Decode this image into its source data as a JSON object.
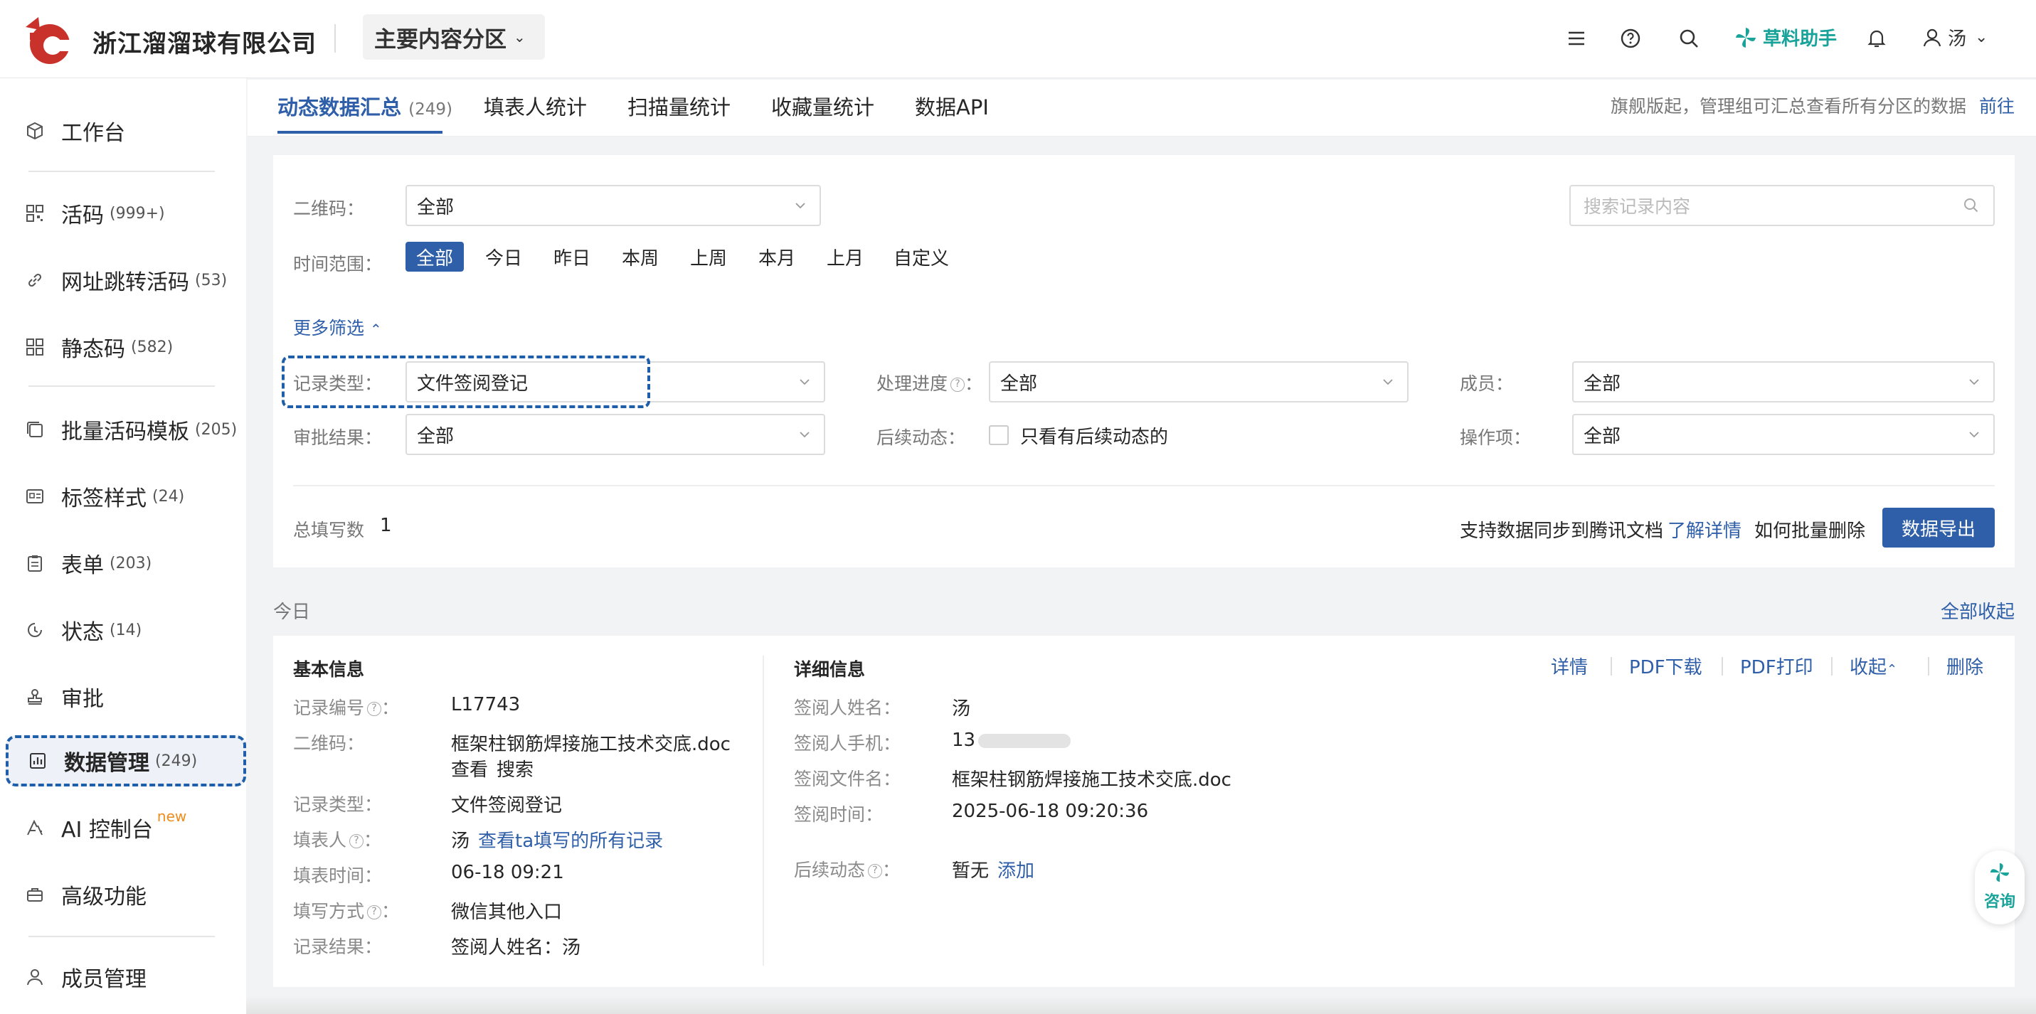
{
  "header": {
    "company": "浙江溜溜球有限公司",
    "zone": "主要内容分区",
    "helper": "草料助手",
    "user": "汤"
  },
  "sidebar": {
    "items": [
      {
        "label": "工作台",
        "count": ""
      },
      {
        "label": "活码",
        "count": "(999+)"
      },
      {
        "label": "网址跳转活码",
        "count": "(53)"
      },
      {
        "label": "静态码",
        "count": "(582)"
      },
      {
        "label": "批量活码模板",
        "count": "(205)"
      },
      {
        "label": "标签样式",
        "count": "(24)"
      },
      {
        "label": "表单",
        "count": "(203)"
      },
      {
        "label": "状态",
        "count": "(14)"
      },
      {
        "label": "审批",
        "count": ""
      },
      {
        "label": "数据管理",
        "count": "(249)"
      },
      {
        "label": "AI 控制台",
        "count": "",
        "tag": "new"
      },
      {
        "label": "高级功能",
        "count": ""
      },
      {
        "label": "成员管理",
        "count": ""
      }
    ]
  },
  "tabs": {
    "items": [
      {
        "label": "动态数据汇总",
        "sub": "(249)"
      },
      {
        "label": "填表人统计",
        "sub": ""
      },
      {
        "label": "扫描量统计",
        "sub": ""
      },
      {
        "label": "收藏量统计",
        "sub": ""
      },
      {
        "label": "数据API",
        "sub": ""
      }
    ],
    "note": "旗舰版起，管理组可汇总查看所有分区的数据",
    "note_link": "前往"
  },
  "filters": {
    "qrcode_label": "二维码：",
    "qrcode_value": "全部",
    "search_placeholder": "搜索记录内容",
    "time_label": "时间范围：",
    "time_options": [
      "全部",
      "今日",
      "昨日",
      "本周",
      "上周",
      "本月",
      "上月",
      "自定义"
    ],
    "more_filters": "更多筛选",
    "record_type_label": "记录类型：",
    "record_type_value": "文件签阅登记",
    "progress_label": "处理进度",
    "progress_value": "全部",
    "member_label": "成员：",
    "member_value": "全部",
    "approval_label": "审批结果：",
    "approval_value": "全部",
    "followup_label": "后续动态：",
    "followup_check": "只看有后续动态的",
    "operation_label": "操作项：",
    "operation_value": "全部",
    "total_label": "总填写数",
    "total_value": "1",
    "sync_text": "支持数据同步到腾讯文档",
    "sync_link": "了解详情",
    "batch_delete": "如何批量删除",
    "export": "数据导出"
  },
  "section": {
    "today": "今日",
    "collapse_all": "全部收起"
  },
  "record": {
    "basic_title": "基本信息",
    "detail_title": "详细信息",
    "actions": [
      "详情",
      "PDF下载",
      "PDF打印",
      "收起",
      "删除"
    ],
    "basic": {
      "id_label": "记录编号",
      "id_value": "L17743",
      "qr_label": "二维码：",
      "qr_value": "框架柱钢筋焊接施工技术交底.doc",
      "qr_view": "查看",
      "qr_search": "搜索",
      "type_label": "记录类型：",
      "type_value": "文件签阅登记",
      "filler_label": "填表人",
      "filler_value": "汤",
      "filler_link": "查看ta填写的所有记录",
      "time_label": "填表时间：",
      "time_value": "06-18 09:21",
      "method_label": "填写方式",
      "method_value": "微信其他入口",
      "result_label": "记录结果：",
      "result_value": "签阅人姓名：汤"
    },
    "detail": {
      "name_label": "签阅人姓名：",
      "name_value": "汤",
      "phone_label": "签阅人手机：",
      "phone_value": "13",
      "file_label": "签阅文件名：",
      "file_value": "框架柱钢筋焊接施工技术交底.doc",
      "time_label": "签阅时间：",
      "time_value": "2025-06-18 09:20:36",
      "follow_label": "后续动态",
      "follow_value": "暂无",
      "follow_add": "添加"
    }
  },
  "consult": {
    "label": "咨询"
  },
  "colors": {
    "primary": "#2f5fa8",
    "brand_red": "#c8322a",
    "helper_teal": "#1aa39a",
    "new_tag": "#f08c1c"
  }
}
